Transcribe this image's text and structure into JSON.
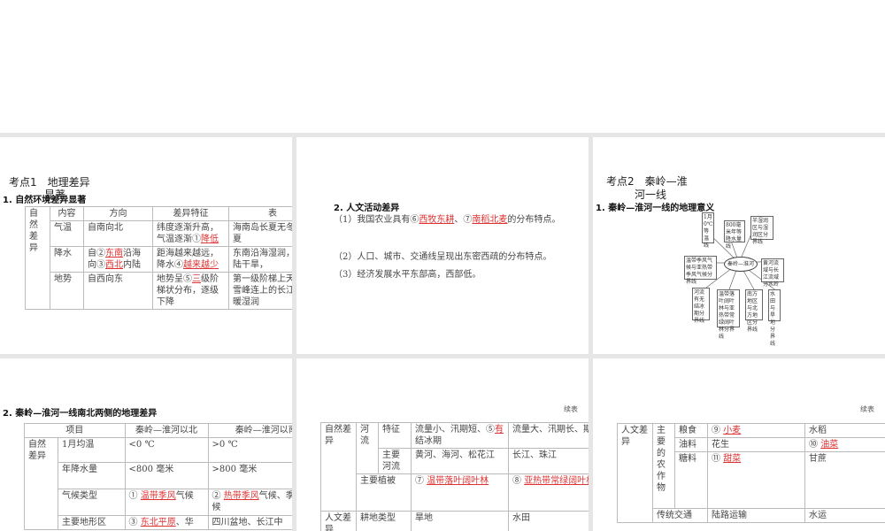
{
  "slide1": {
    "title_a": "考点1　地理差异",
    "title_b": "显著",
    "sub": "1. 自然环境差异显著",
    "header": [
      "内容",
      "方向",
      "差异特征",
      "表"
    ],
    "group": "自然差异",
    "rows": [
      {
        "item": "气温",
        "dir": "自南向北",
        "feat_a": "纬度逐渐升高，气温逐渐①",
        "feat_red": "降低",
        "perf": "海南岛长夏无冬，短夏"
      },
      {
        "item": "降水",
        "dir_a": "自②",
        "dir_red1": "东南",
        "dir_b": "沿海向③",
        "dir_red2": "西北",
        "dir_c": "内陆",
        "feat_a": "距海越来越远，降水④",
        "feat_red": "越来越少",
        "perf": "东南沿海湿润，北内陆干旱，"
      },
      {
        "item": "地势",
        "dir": "自西向东",
        "feat_a": "地势呈⑤",
        "feat_red": "三",
        "feat_b": "级阶梯状分布，逐级下降",
        "perf": "第一级阶梯上天寒、雪峰连上的长江三角暖湿润"
      }
    ]
  },
  "slide2": {
    "title": "2. 人文活动差异",
    "p1_a": "（1）我国农业具有⑥",
    "p1_red1": "西牧东耕",
    "p1_b": "、⑦",
    "p1_red2": "南稻北麦",
    "p1_c": "的分布特点。",
    "p2": "（2）人口、城市、交通线呈现出东密西疏的分布特点。",
    "p3": "（3）经济发展水平东部高，西部低。"
  },
  "slide3": {
    "title_a": "考点2　秦岭—淮",
    "title_b": "河一线",
    "sub": "1. 秦岭—淮河一线的地理意义",
    "center": "秦岭—淮河",
    "boxes": [
      "1月0℃等温线",
      "800毫米年等降水量线",
      "半湿润区与湿润区分界线",
      "黄河流域与长江流域分水岭",
      "温带季风气候与亚热带季风气候分界线",
      "河流有无结冰期分界线",
      "温带落叶阔叶林与亚热带常绿阔叶林分界线",
      "南方地区与北方地区分界线",
      "水田与旱地分界线"
    ]
  },
  "slide4": {
    "sub": "2. 秦岭—淮河一线南北两侧的地理差异",
    "header": [
      "项目",
      "秦岭—淮河以北",
      "秦岭—淮河以南"
    ],
    "group": "自然差异",
    "rows": [
      {
        "item": "1月均温",
        "north": "<0 ℃",
        "south": ">0 ℃"
      },
      {
        "item": "年降水量",
        "north": "<800 毫米",
        "south": ">800 毫米"
      },
      {
        "item": "气候类型",
        "north_a": "① ",
        "north_red": "温带季风",
        "north_b": "气候",
        "south_a": "② ",
        "south_red": "热带季风",
        "south_b": "气候、季风气候"
      },
      {
        "item": "主要地形区",
        "north_a": "③ ",
        "north_red": "东北平原",
        "north_b": "、华",
        "south": "四川盆地、长江中"
      }
    ]
  },
  "slide5": {
    "cont": "续表",
    "group1": "自然差异",
    "river": "河流",
    "feat": "特征",
    "north_feat_a": "流量小、汛期短、⑤",
    "north_feat_red": "有",
    "north_feat_b": "结冰期",
    "south_feat": "流量大、汛期长、期",
    "main_river": "主要河流",
    "north_rivers": "黄河、海河、松花江",
    "south_rivers": "长江、珠江",
    "veg": "主要植被",
    "north_veg_a": "⑦ ",
    "north_veg_red": "温带落叶阔叶林",
    "south_veg_a": "⑧ ",
    "south_veg_red": "亚热带常绿阔叶林",
    "group2": "人文差异",
    "farm": "耕地类型",
    "north_farm": "旱地",
    "south_farm": "水田"
  },
  "slide6": {
    "cont": "续表",
    "group": "人文差异",
    "crops": "主要的农作物",
    "rows": [
      {
        "item": "粮食",
        "north_a": "⑨ ",
        "north_red": "小麦",
        "south": "水稻"
      },
      {
        "item": "油料",
        "north": "花生",
        "south_a": "⑩ ",
        "south_red": "油菜"
      },
      {
        "item": "糖料",
        "north_a": "⑪ ",
        "north_red": "甜菜",
        "south": "甘蔗"
      }
    ],
    "trans": "传统交通",
    "north_trans": "陆路运输",
    "south_trans": "水运"
  }
}
